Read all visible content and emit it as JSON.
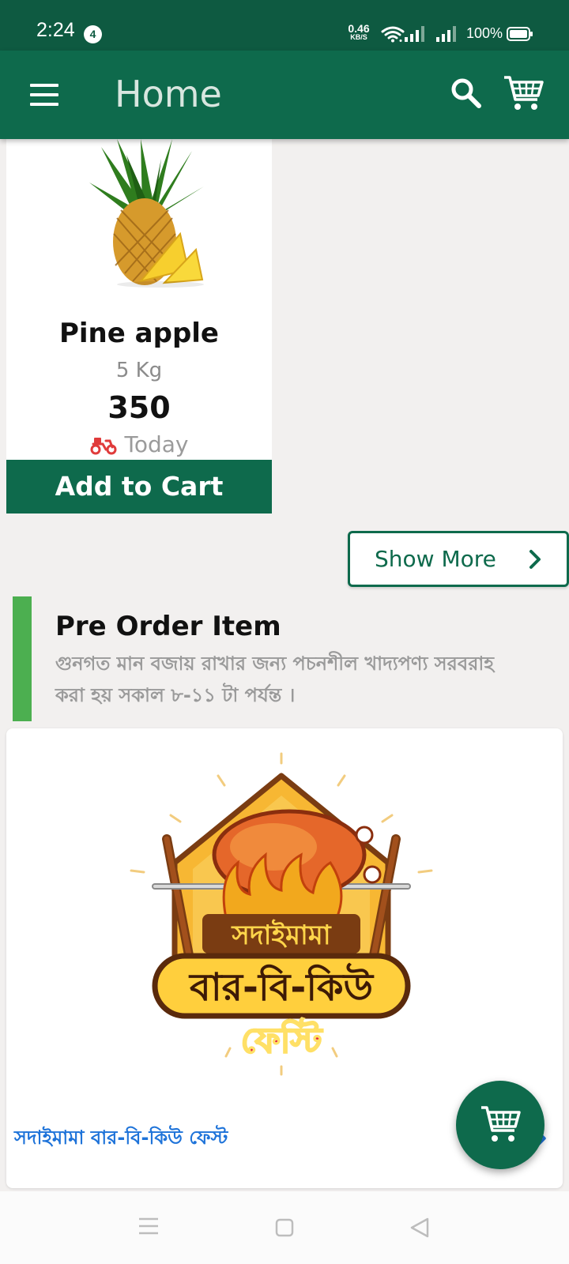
{
  "status_bar": {
    "time": "2:24",
    "notification_count": "4",
    "net_speed_value": "0.46",
    "net_speed_unit": "KB/S",
    "battery": "100%"
  },
  "app_bar": {
    "title": "Home"
  },
  "product": {
    "name": "Pine apple",
    "unit": "5 Kg",
    "price": "350",
    "delivery": "Today",
    "add_to_cart_label": "Add to Cart"
  },
  "show_more_label": "Show More",
  "pre_order": {
    "title": "Pre Order Item",
    "subtitle": "গুনগত মান বজায় রাখার জন্য পচনশীল খাদ্যপণ্য সরবরাহ করা হয় সকাল ৮-১১ টা পর্যন্ত ।"
  },
  "promo": {
    "logo_text_top": "সদাইমামা",
    "logo_text_main": "বার-বি-কিউ",
    "logo_text_bottom": "ফেস্টি",
    "link_label": "সদাইমামা বার-বি-কিউ ফেস্ট"
  },
  "colors": {
    "status_bar": "#0e5a41",
    "primary": "#0e6a4c",
    "accent_bar": "#4caf50",
    "link": "#1e73d9",
    "background": "#f2f0ef"
  },
  "icons": [
    "menu-icon",
    "search-icon",
    "cart-icon",
    "scooter-icon",
    "chevron-right-icon",
    "wifi-icon",
    "signal-icon",
    "battery-icon"
  ]
}
